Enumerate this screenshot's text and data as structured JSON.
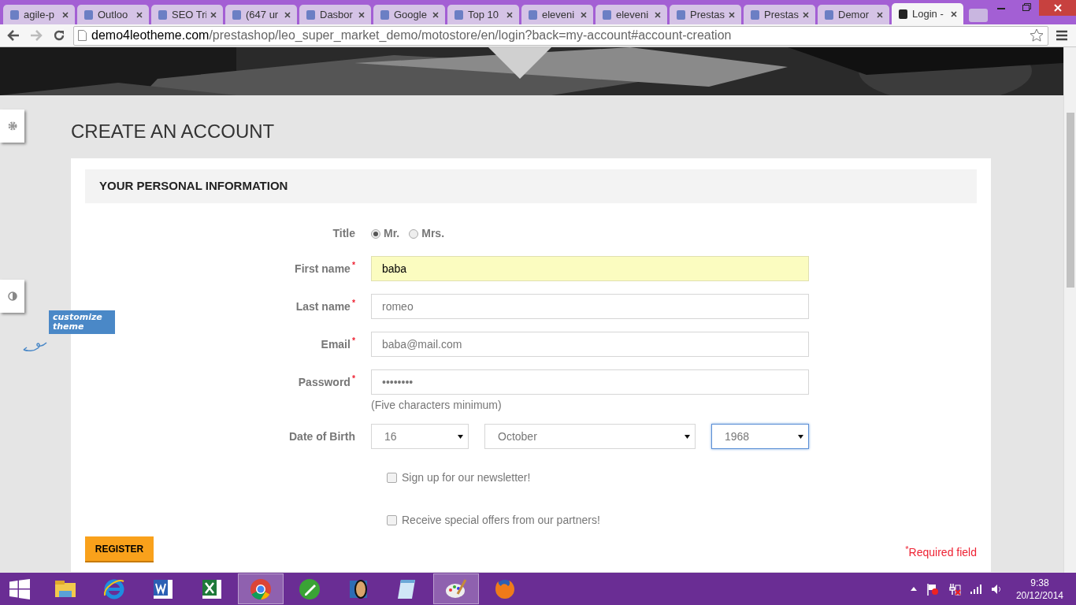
{
  "browser": {
    "tabs": [
      {
        "title": "agile-p",
        "selected": false
      },
      {
        "title": "Outloo",
        "selected": false
      },
      {
        "title": "SEO Tri",
        "selected": false
      },
      {
        "title": "(647 ur",
        "selected": false
      },
      {
        "title": "Dasbor",
        "selected": false
      },
      {
        "title": "Google",
        "selected": false
      },
      {
        "title": "Top 10",
        "selected": false
      },
      {
        "title": "eleveni",
        "selected": false
      },
      {
        "title": "eleveni",
        "selected": false
      },
      {
        "title": "Prestas",
        "selected": false
      },
      {
        "title": "Prestas",
        "selected": false
      },
      {
        "title": "Demor",
        "selected": false
      },
      {
        "title": "Login -",
        "selected": true
      }
    ],
    "url": {
      "host": "demo4leotheme.com",
      "path": "/prestashop/leo_super_market_demo/motostore/en/login?back=my-account#account-creation"
    }
  },
  "page": {
    "heading": "CREATE AN ACCOUNT",
    "section_title": "YOUR PERSONAL INFORMATION",
    "customize_label": "customize theme",
    "title_field": {
      "label": "Title",
      "options": [
        {
          "label": "Mr.",
          "selected": true
        },
        {
          "label": "Mrs.",
          "selected": false
        }
      ]
    },
    "fields": [
      {
        "label": "First name",
        "required": true,
        "value": "baba",
        "focused": true
      },
      {
        "label": "Last name",
        "required": true,
        "value": "romeo",
        "focused": false
      },
      {
        "label": "Email",
        "required": true,
        "value": "baba@mail.com",
        "focused": false
      },
      {
        "label": "Password",
        "required": true,
        "value": "••••••••",
        "focused": false,
        "hint": "(Five characters minimum)"
      }
    ],
    "birth": {
      "label": "Date of Birth",
      "selects": [
        {
          "value": "16",
          "focused": false
        },
        {
          "value": "October",
          "focused": false
        },
        {
          "value": "1968",
          "focused": true
        }
      ]
    },
    "checkboxes": [
      {
        "label": "Sign up for our newsletter!",
        "checked": false
      },
      {
        "label": "Receive special offers from our partners!",
        "checked": false
      }
    ],
    "register": "REGISTER",
    "required_mark": "*",
    "required_note": "Required field"
  },
  "taskbar": {
    "apps": [
      {
        "kind": "files",
        "selected": false
      },
      {
        "kind": "ie",
        "selected": false
      },
      {
        "kind": "word",
        "selected": false
      },
      {
        "kind": "excel",
        "selected": false
      },
      {
        "kind": "chrome",
        "selected": true
      },
      {
        "kind": "pen",
        "selected": false
      },
      {
        "kind": "viewer",
        "selected": false
      },
      {
        "kind": "notepad",
        "selected": false
      },
      {
        "kind": "paint",
        "selected": true
      },
      {
        "kind": "firefox",
        "selected": false
      }
    ],
    "time": "9:38",
    "date": "20/12/2014"
  }
}
